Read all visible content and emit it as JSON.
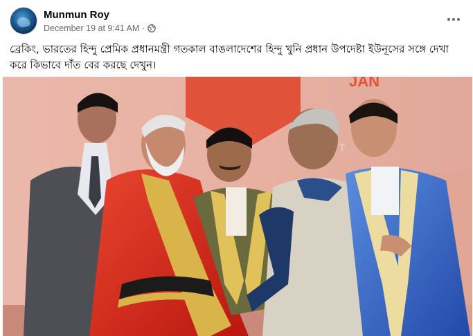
{
  "post": {
    "author": "Munmun Roy",
    "timestamp": "December 19 at 9:41 AM",
    "separator": "·",
    "privacy_icon": "globe-icon",
    "more_icon": "more-options-icon",
    "caption": "ব্রেকিং, ভারতের হিন্দু প্রেমিক প্রধানমন্ত্রী গতকাল বাঙলাদেশের হিন্দু খুনি প্রধান উপদেষ্টা ইউনূসের সঙ্গে দেখা করে কিভাবে দাঁত বের করছে দেখুন।"
  },
  "photo": {
    "banner_text": "JAN",
    "banner_partial": "T",
    "colors": {
      "background": "#dea292",
      "banner": "#e0533a",
      "red_gown": "#d5281c",
      "gold_trim": "#d9b44a",
      "blue_gown": "#2f63c6",
      "suit": "#4e4f55"
    }
  }
}
